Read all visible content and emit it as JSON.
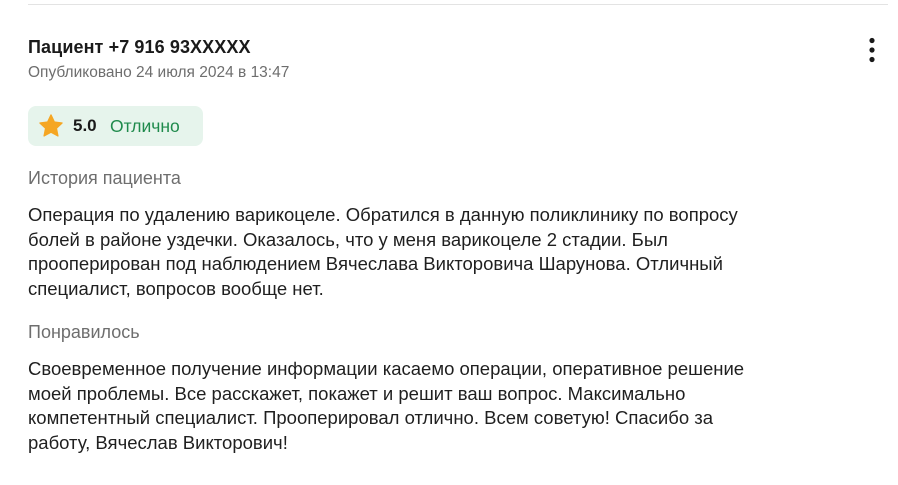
{
  "review": {
    "author": "Пациент +7 916 93XXXXX",
    "published": "Опубликовано 24 июля 2024 в 13:47",
    "rating": {
      "value": "5.0",
      "label": "Отлично",
      "icon": "star-icon",
      "star_color": "#f5a623",
      "badge_color": "#e6f4ec",
      "label_color": "#1f8a4c"
    },
    "menu_icon": "more-vertical-icon",
    "sections": [
      {
        "title": "История пациента",
        "lines": [
          "Операция по удалению варикоцеле. Обратился в данную поликлинику по вопросу",
          "болей в районе уздечки. Оказалось, что у меня варикоцеле 2 стадии. Был",
          "прооперирован под наблюдением Вячеслава Викторовича Шарунова. Отличный",
          "специалист, вопросов вообще нет."
        ]
      },
      {
        "title": "Понравилось",
        "lines": [
          "Своевременное получение информации касаемо операции, оперативное решение",
          "моей проблемы. Все расскажет, покажет и решит ваш вопрос. Максимально",
          "компетентный специалист. Прооперировал отлично. Всем советую! Спасибо за",
          "работу, Вячеслав Викторович!"
        ]
      }
    ]
  }
}
